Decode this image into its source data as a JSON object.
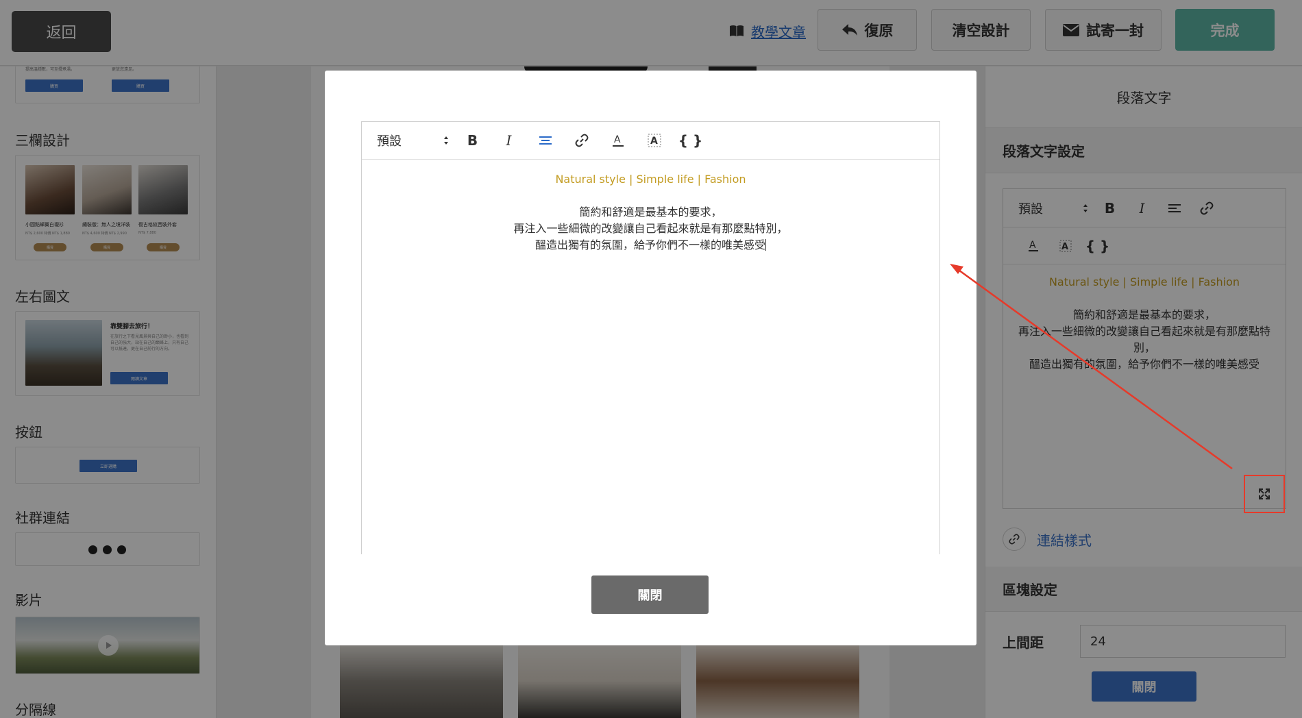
{
  "topbar": {
    "back_label": "返回",
    "tutorial_label": "教學文章",
    "undo_label": "復原",
    "clear_label": "清空設計",
    "test_send_label": "試寄一封",
    "done_label": "完成"
  },
  "sidebar": {
    "sections": {
      "three_col": "三欄設計",
      "left_right": "左右圖文",
      "button": "按鈕",
      "social": "社群連結",
      "video": "影片",
      "divider": "分隔線"
    },
    "top_card": {
      "text_left": "提高溫穩數，可至擺煮湯。",
      "text_right": "更放您遠足。",
      "btn_left": "購買",
      "btn_right": "購買"
    },
    "three_col_items": [
      {
        "name": "小圓點蟬翼白襯衫",
        "price": "NT$ 2,600 特價 NT$ 1,880",
        "btn": "購買"
      },
      {
        "name": "繡裝版：無人之境洋裝",
        "price": "NT$ 4,600 特價 NT$ 2,990",
        "btn": "購買"
      },
      {
        "name": "復古格紋西裝外套",
        "price": "NT$ 7,880",
        "btn": "購買"
      }
    ],
    "lr_card": {
      "title": "靠雙腳去旅行！",
      "body": "在旅行之下看見風景與自己的渺小，也看到自己的強大，站在自己的巔峰上，只有自己可以抵達，更在自己前行的方向。",
      "btn": "閱讀文章"
    },
    "button_card": {
      "btn": "立即選購"
    }
  },
  "right_panel": {
    "title": "段落文字",
    "settings_header": "段落文字設定",
    "select_value": "預設",
    "content_lines": [
      "Natural style | Simple life | Fashion",
      "簡約和舒適是最基本的要求，",
      "再注入一些細微的改變讓自己看起來就是有那麼點特別，",
      "醞造出獨有的氛圍，給予你們不一樣的唯美感受"
    ],
    "link_style_label": "連結樣式",
    "block_header": "區塊設定",
    "top_margin_label": "上間距",
    "top_margin_value": "24",
    "close_label": "關閉"
  },
  "modal": {
    "select_value": "預設",
    "line_1": "Natural style | Simple life | Fashion",
    "line_2": "簡約和舒適是最基本的要求，",
    "line_3": "再注入一些細微的改變讓自己看起來就是有那麼點特別，",
    "line_4": "醞造出獨有的氛圍，給予你們不一樣的唯美感受",
    "close_label": "關閉"
  },
  "colors": {
    "accent_blue": "#3c74c9",
    "done_green": "#5eb7a6",
    "gold_text": "#c39c22",
    "annotation_red": "#e63a2a"
  }
}
